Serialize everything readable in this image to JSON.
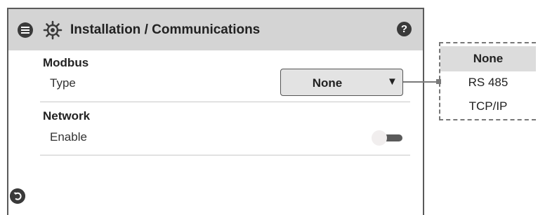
{
  "header": {
    "title": "Installation / Communications",
    "help_label": "?"
  },
  "modbus": {
    "title": "Modbus",
    "type_label": "Type",
    "type_value": "None",
    "arrow": "▼"
  },
  "network": {
    "title": "Network",
    "enable_label": "Enable",
    "enabled": false
  },
  "options": [
    "None",
    "RS 485",
    "TCP/IP"
  ],
  "colors": {
    "header_bg": "#d4d4d4",
    "icon_dark": "#3a3a3a",
    "dropdown_bg": "#e3e3e3",
    "selected_option_bg": "#dcdcdc"
  }
}
